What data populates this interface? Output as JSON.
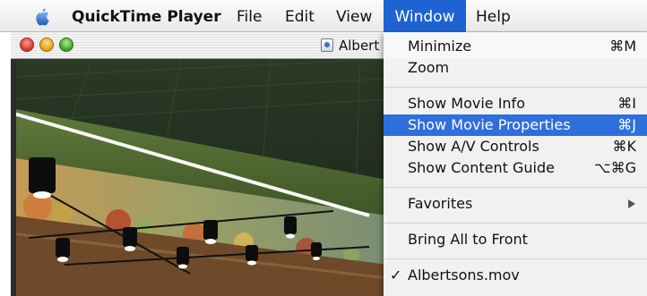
{
  "menubar": {
    "app_name": "QuickTime Player",
    "file": "File",
    "edit": "Edit",
    "view": "View",
    "window": "Window",
    "help": "Help"
  },
  "movie_window": {
    "title": "Albert"
  },
  "window_menu": {
    "minimize": {
      "label": "Minimize",
      "shortcut": "⌘M"
    },
    "zoom": {
      "label": "Zoom"
    },
    "show_movie_info": {
      "label": "Show Movie Info",
      "shortcut": "⌘I"
    },
    "show_movie_properties": {
      "label": "Show Movie Properties",
      "shortcut": "⌘J"
    },
    "show_av_controls": {
      "label": "Show A/V Controls",
      "shortcut": "⌘K"
    },
    "show_content_guide": {
      "label": "Show Content Guide",
      "shortcut": "⌥⌘G"
    },
    "favorites": {
      "label": "Favorites"
    },
    "bring_all_to_front": {
      "label": "Bring All to Front"
    },
    "albertsons": {
      "label": "Albertsons.mov",
      "checkmark": "✓"
    }
  },
  "colors": {
    "highlight": "#2f6fdc",
    "menu_title_selected": "#1e63d1"
  }
}
